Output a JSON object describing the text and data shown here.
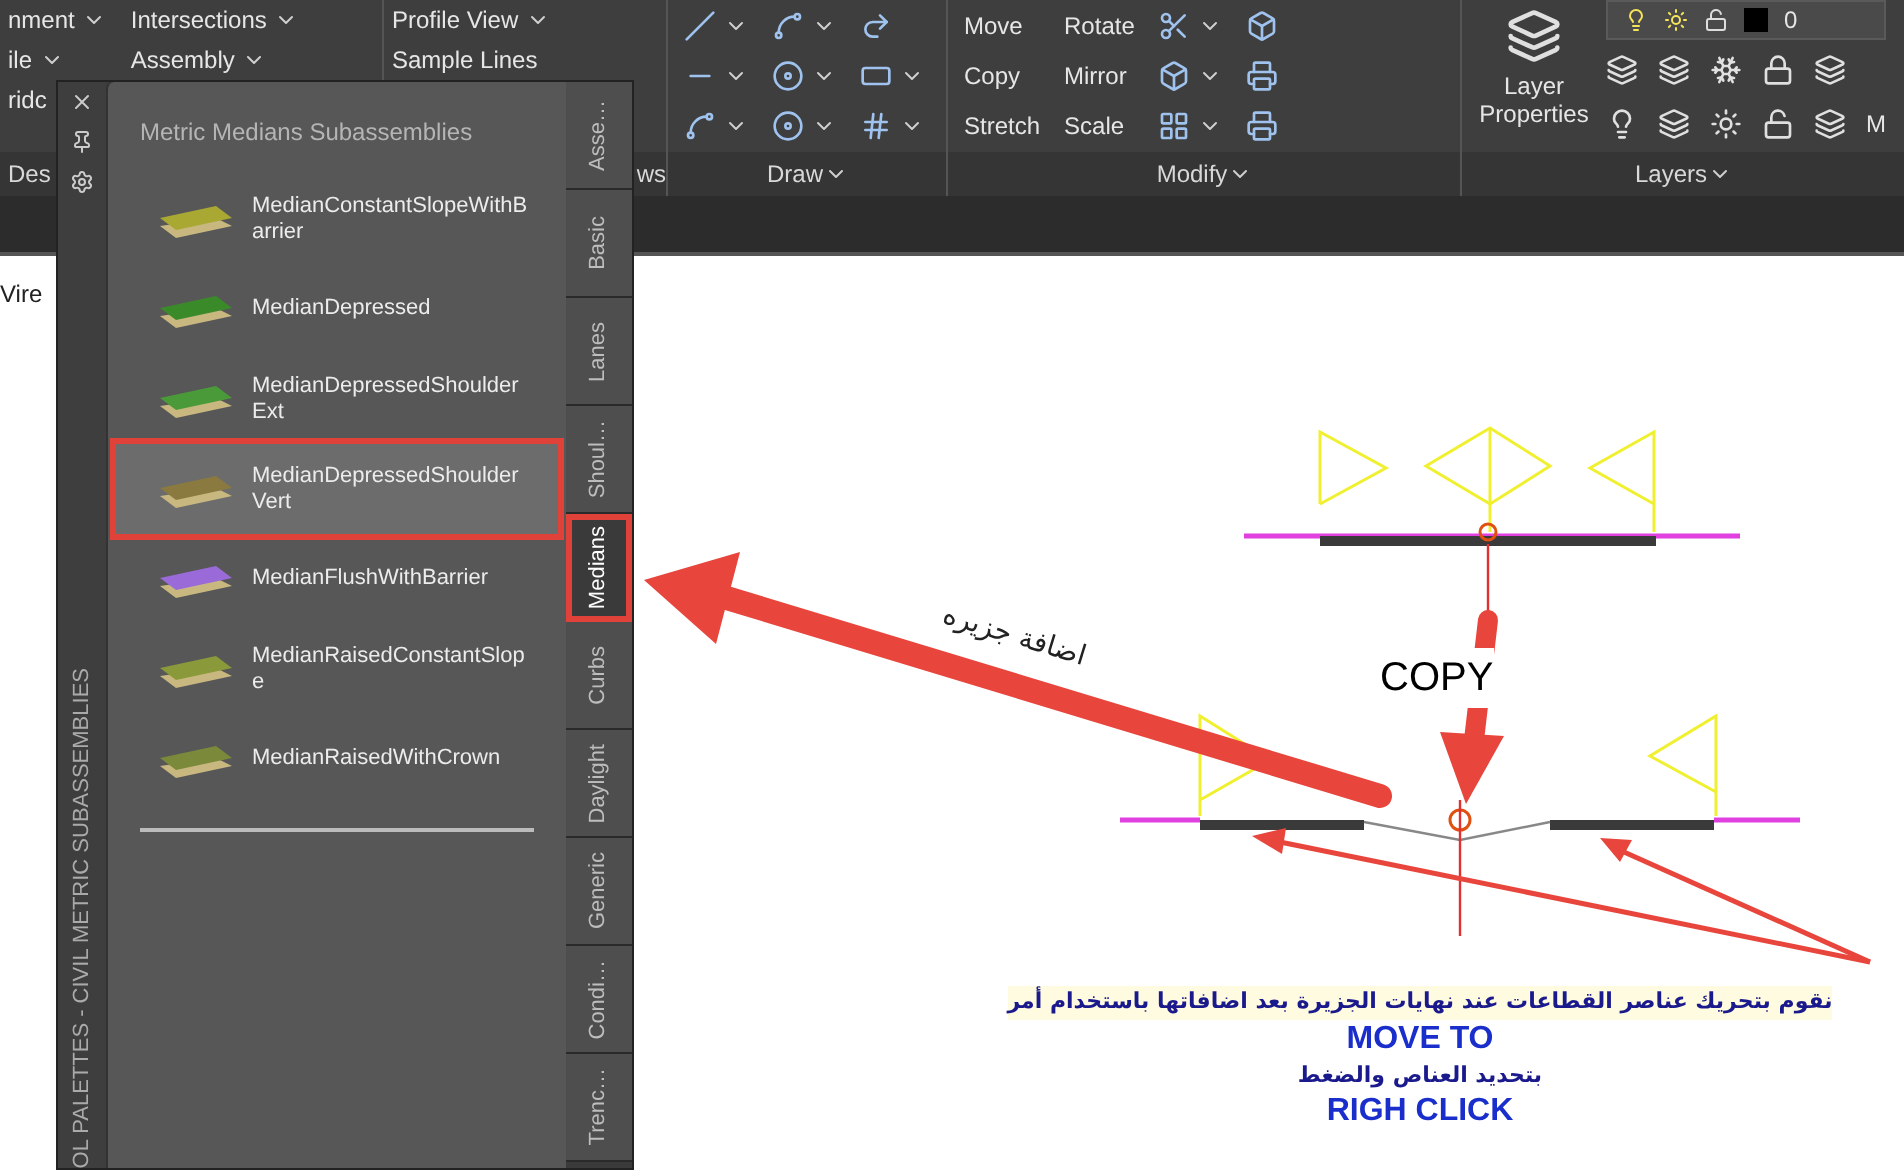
{
  "ribbon": {
    "panels": [
      {
        "title": "Des",
        "title_menu": false,
        "columns": [
          {
            "rows": [
              {
                "label": "nment",
                "menu": true
              },
              {
                "label": "ile",
                "menu": true
              },
              {
                "label": "ridc",
                "menu": false
              }
            ]
          },
          {
            "rows": [
              {
                "label": "Intersections",
                "menu": true
              },
              {
                "label": "Assembly",
                "menu": true
              }
            ]
          }
        ]
      },
      {
        "title": "ws",
        "title_menu": false,
        "columns": [
          {
            "rows": [
              {
                "label": "Profile View",
                "menu": true
              },
              {
                "label": "Sample Lines",
                "menu": false
              }
            ]
          }
        ]
      },
      {
        "title": "Draw",
        "title_menu": true,
        "columns": [
          {
            "rows": [
              {
                "menu": true
              },
              {
                "menu": true
              },
              {
                "menu": true
              }
            ]
          },
          {
            "rows": [
              {
                "menu": true
              },
              {
                "menu": true
              },
              {
                "menu": true
              }
            ]
          },
          {
            "rows": [
              {
                "menu": false
              },
              {
                "menu": true
              },
              {
                "menu": true
              }
            ]
          }
        ]
      },
      {
        "title": "Modify",
        "title_menu": true,
        "columns": [
          {
            "rows": [
              {
                "label": "Move",
                "menu": false
              },
              {
                "label": "Copy",
                "menu": false
              },
              {
                "label": "Stretch",
                "menu": false
              }
            ]
          },
          {
            "rows": [
              {
                "label": "Rotate",
                "menu": false
              },
              {
                "label": "Mirror",
                "menu": false
              },
              {
                "label": "Scale",
                "menu": false
              }
            ]
          },
          {
            "rows": [
              {
                "menu": true
              },
              {
                "menu": true
              },
              {
                "menu": true
              }
            ]
          },
          {
            "rows": [
              {
                "menu": false
              },
              {
                "menu": false
              },
              {
                "menu": false
              }
            ]
          }
        ]
      }
    ],
    "layers": {
      "title": "Layers",
      "title_menu": true,
      "big_button": "Layer Properties",
      "current_layer": "0",
      "cut_label": "M"
    }
  },
  "palette": {
    "side_title": "OL PALETTES - CIVIL METRIC SUBASSEMBLIES",
    "heading": "Metric Medians Subassemblies",
    "items": [
      {
        "lines": [
          "MedianConstantSlopeWithB",
          "arrier"
        ],
        "selected": false
      },
      {
        "lines": [
          "MedianDepressed"
        ],
        "selected": false
      },
      {
        "lines": [
          "MedianDepressedShoulder",
          "Ext"
        ],
        "selected": false
      },
      {
        "lines": [
          "MedianDepressedShoulder",
          "Vert"
        ],
        "selected": true
      },
      {
        "lines": [
          "MedianFlushWithBarrier"
        ],
        "selected": false
      },
      {
        "lines": [
          "MedianRaisedConstantSlop",
          "e"
        ],
        "selected": false
      },
      {
        "lines": [
          "MedianRaisedWithCrown"
        ],
        "selected": false
      }
    ],
    "tabs": [
      {
        "label": "Asse…",
        "selected": false
      },
      {
        "label": "Basic",
        "selected": false
      },
      {
        "label": "Lanes",
        "selected": false
      },
      {
        "label": "Shoul…",
        "selected": false
      },
      {
        "label": "Medians",
        "selected": true
      },
      {
        "label": "Curbs",
        "selected": false
      },
      {
        "label": "Daylight",
        "selected": false
      },
      {
        "label": "Generic",
        "selected": false
      },
      {
        "label": "Condi…",
        "selected": false
      },
      {
        "label": "Trenc…",
        "selected": false
      }
    ]
  },
  "canvas": {
    "side_text": "Vire",
    "copy_label": "COPY",
    "island_label": "اضافة جزيره",
    "note": "نقوم بتحريك عناصر القطاعات عند نهايات الجزيرة بعد اضافاتها باستخدام أمر",
    "move_to": "MOVE TO",
    "select_note": "بتحديد العناص والضغط",
    "right_click": "RIGH CLICK"
  }
}
